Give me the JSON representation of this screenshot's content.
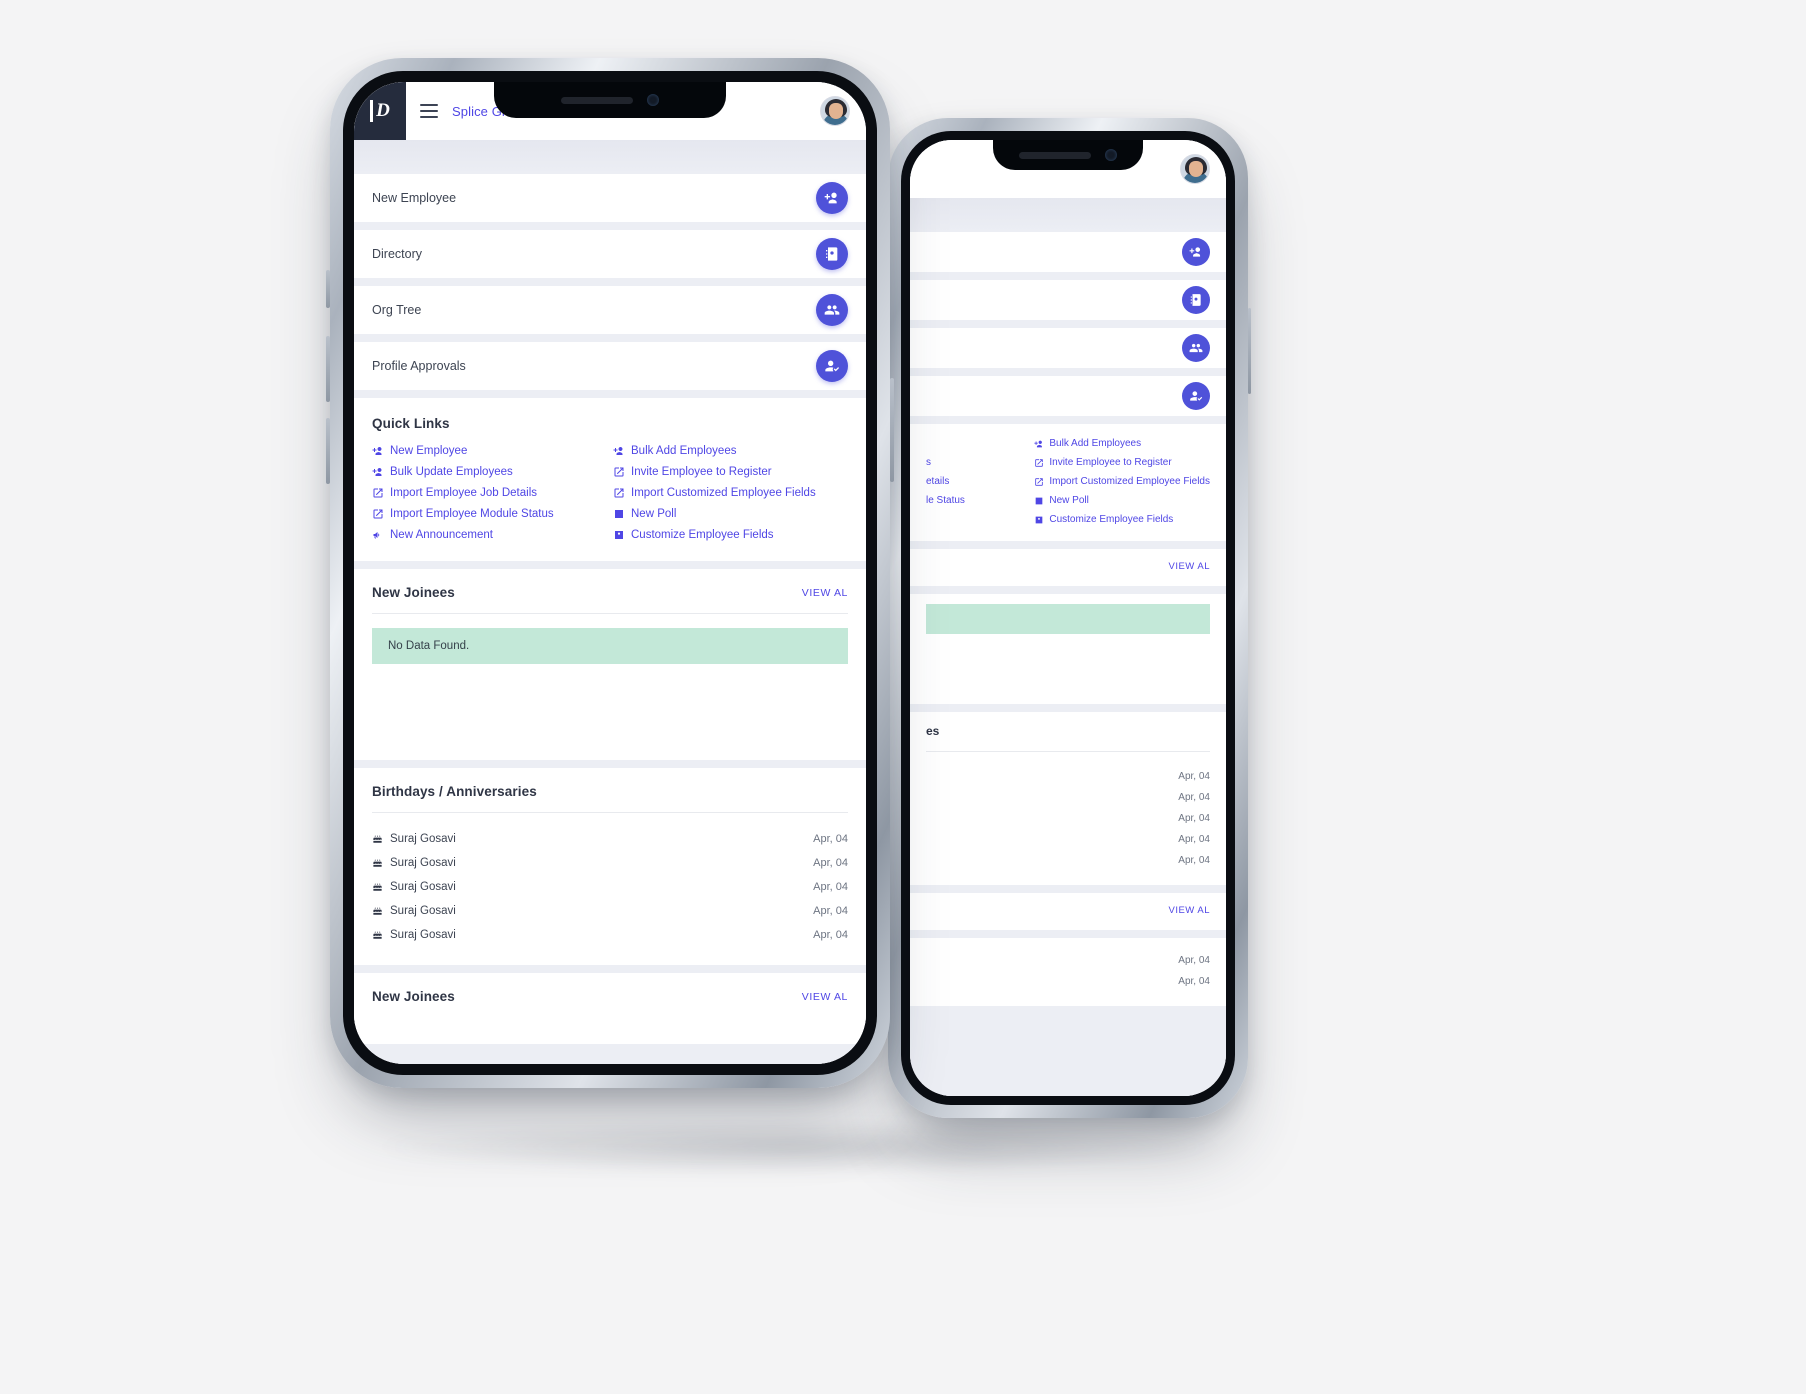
{
  "app": {
    "brand_glyph": "D",
    "org_name": "Splice Global",
    "gear_icon": "gear-icon",
    "menu_icon": "hamburger-icon",
    "avatar_icon": "user-avatar"
  },
  "actions": [
    {
      "label": "New Employee",
      "icon": "user-plus-icon"
    },
    {
      "label": "Directory",
      "icon": "address-book-icon"
    },
    {
      "label": "Org Tree",
      "icon": "users-icon"
    },
    {
      "label": "Profile Approvals",
      "icon": "user-check-icon"
    }
  ],
  "quick_links": {
    "title": "Quick Links",
    "items": [
      {
        "label": "New Employee",
        "icon": "user-plus-icon"
      },
      {
        "label": "Bulk Add Employees",
        "icon": "user-plus-icon"
      },
      {
        "label": "Bulk Update Employees",
        "icon": "user-plus-icon"
      },
      {
        "label": "Invite Employee to Register",
        "icon": "external-link-icon"
      },
      {
        "label": "Import Employee Job Details",
        "icon": "external-link-icon"
      },
      {
        "label": "Import Customized Employee Fields",
        "icon": "external-link-icon"
      },
      {
        "label": "Import Employee Module Status",
        "icon": "external-link-icon"
      },
      {
        "label": "New Poll",
        "icon": "poll-icon"
      },
      {
        "label": "New Announcement",
        "icon": "megaphone-icon"
      },
      {
        "label": "Customize Employee Fields",
        "icon": "id-card-icon"
      }
    ]
  },
  "new_joinees": {
    "title": "New Joinees",
    "view_all": "VIEW AL",
    "empty_message": "No Data Found."
  },
  "birthdays": {
    "title": "Birthdays / Anniversaries",
    "rows": [
      {
        "name": "Suraj Gosavi",
        "date": "Apr, 04",
        "icon": "cake-icon"
      },
      {
        "name": "Suraj Gosavi",
        "date": "Apr, 04",
        "icon": "cake-icon"
      },
      {
        "name": "Suraj Gosavi",
        "date": "Apr, 04",
        "icon": "cake-icon"
      },
      {
        "name": "Suraj Gosavi",
        "date": "Apr, 04",
        "icon": "cake-icon"
      },
      {
        "name": "Suraj Gosavi",
        "date": "Apr, 04",
        "icon": "cake-icon"
      }
    ]
  },
  "new_joinees_bottom": {
    "title": "New Joinees",
    "view_all": "VIEW AL"
  },
  "back_phone": {
    "quick_links_right": [
      "Bulk Add Employees",
      "Invite Employee to Register",
      "Import Customized Employee Fields",
      "New Poll",
      "Customize Employee Fields"
    ],
    "quick_links_left_partial": [
      "s",
      "etails",
      "le Status"
    ],
    "view_all_1": "VIEW AL",
    "view_all_2": "VIEW AL",
    "section_partial_title": "es",
    "dates": [
      "Apr, 04",
      "Apr, 04",
      "Apr, 04",
      "Apr, 04",
      "Apr, 04"
    ],
    "dates_2": [
      "Apr, 04",
      "Apr, 04"
    ]
  },
  "colors": {
    "accent": "#4f46e5",
    "fab": "#4f52d9",
    "brand_dark": "#252c3d",
    "empty_bg": "#c3e8d8",
    "page_bg": "#eceef4"
  }
}
